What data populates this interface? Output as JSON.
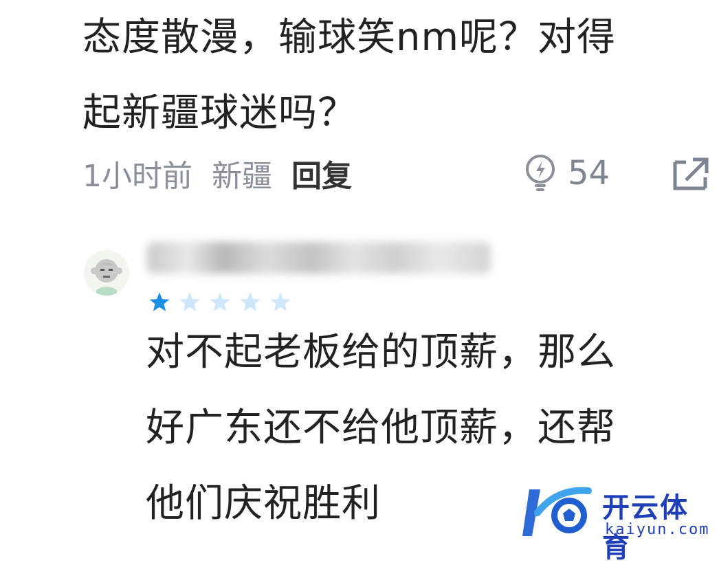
{
  "comment1": {
    "lines": [
      "态度散漫，输球笑nm呢？对得",
      "起新疆球迷吗？"
    ],
    "time": "1小时前",
    "location": "新疆",
    "reply_label": "回复",
    "like_count": "54"
  },
  "comment2": {
    "username": "",
    "rating": 1,
    "rating_max": 5,
    "lines": [
      "对不起老板给的顶薪，那么",
      "好广东还不给他顶薪，还帮",
      "他们庆祝胜利"
    ]
  },
  "watermark": {
    "cn": "开云体育",
    "en": "kaiyun.com"
  },
  "colors": {
    "star_filled": "#1f8fe3",
    "star_empty": "#cde6f8",
    "brand": "#1e3fb8"
  }
}
